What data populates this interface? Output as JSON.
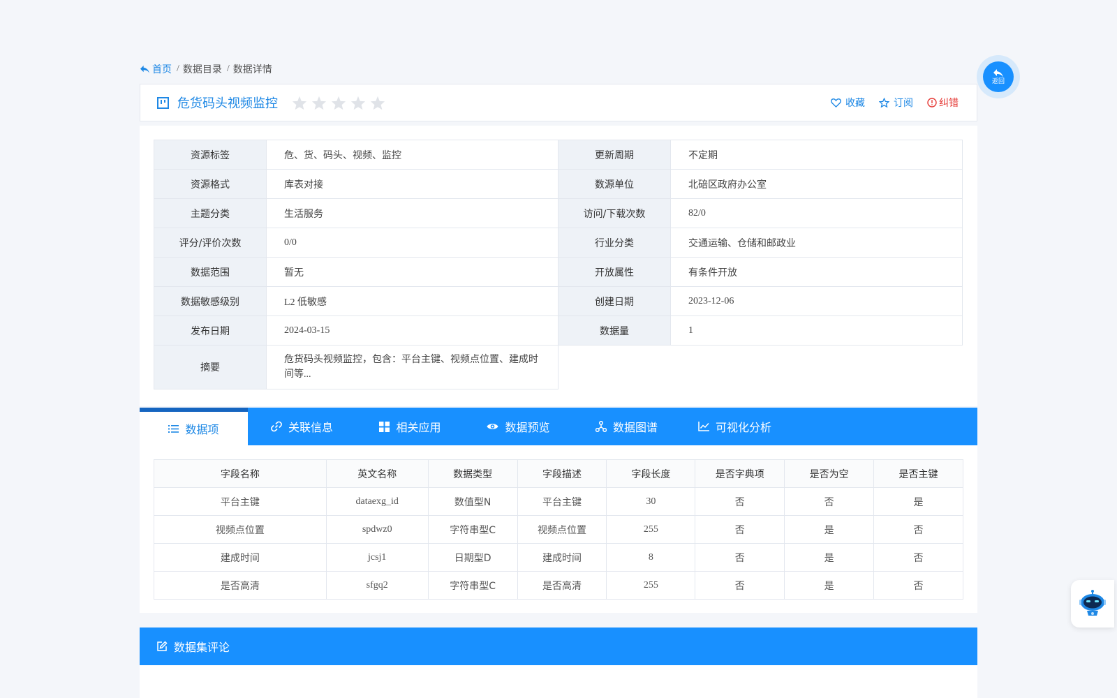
{
  "breadcrumb": {
    "home": "首页",
    "sep": "/",
    "items": [
      "数据目录",
      "数据详情"
    ]
  },
  "back_button": {
    "label": "返回"
  },
  "title": {
    "text": "危货码头视频监控",
    "rating_stars": 0,
    "rating_max": 5,
    "actions": {
      "favorite": "收藏",
      "subscribe": "订阅",
      "report_error": "纠错"
    }
  },
  "info": {
    "rows": [
      {
        "k1": "资源标签",
        "v1": "危、货、码头、视频、监控",
        "k2": "更新周期",
        "v2": "不定期"
      },
      {
        "k1": "资源格式",
        "v1": "库表对接",
        "k2": "数源单位",
        "v2": "北碚区政府办公室"
      },
      {
        "k1": "主题分类",
        "v1": "生活服务",
        "k2": "访问/下载次数",
        "v2": "82/0"
      },
      {
        "k1": "评分/评价次数",
        "v1": "0/0",
        "k2": "行业分类",
        "v2": "交通运输、仓储和邮政业"
      },
      {
        "k1": "数据范围",
        "v1": "暂无",
        "k2": "开放属性",
        "v2": "有条件开放"
      },
      {
        "k1": "数据敏感级别",
        "v1": "L2 低敏感",
        "k2": "创建日期",
        "v2": "2023-12-06"
      },
      {
        "k1": "发布日期",
        "v1": "2024-03-15",
        "k2": "数据量",
        "v2": "1"
      }
    ],
    "summary": {
      "k": "摘要",
      "v": "危货码头视频监控，包含：平台主键、视频点位置、建成时间等..."
    }
  },
  "tabs": [
    "数据项",
    "关联信息",
    "相关应用",
    "数据预览",
    "数据图谱",
    "可视化分析"
  ],
  "fields": {
    "headers": [
      "字段名称",
      "英文名称",
      "数据类型",
      "字段描述",
      "字段长度",
      "是否字典项",
      "是否为空",
      "是否主键"
    ],
    "rows": [
      [
        "平台主键",
        "dataexg_id",
        "数值型N",
        "平台主键",
        "30",
        "否",
        "否",
        "是"
      ],
      [
        "视频点位置",
        "spdwz0",
        "字符串型C",
        "视频点位置",
        "255",
        "否",
        "是",
        "否"
      ],
      [
        "建成时间",
        "jcsj1",
        "日期型D",
        "建成时间",
        "8",
        "否",
        "是",
        "否"
      ],
      [
        "是否高清",
        "sfgq2",
        "字符串型C",
        "是否高清",
        "255",
        "否",
        "是",
        "否"
      ]
    ]
  },
  "comments": {
    "title": "数据集评论"
  },
  "colors": {
    "primary": "#1890ff",
    "link": "#1e88e5",
    "danger": "#e53935",
    "star_empty": "#e0e3e8"
  }
}
